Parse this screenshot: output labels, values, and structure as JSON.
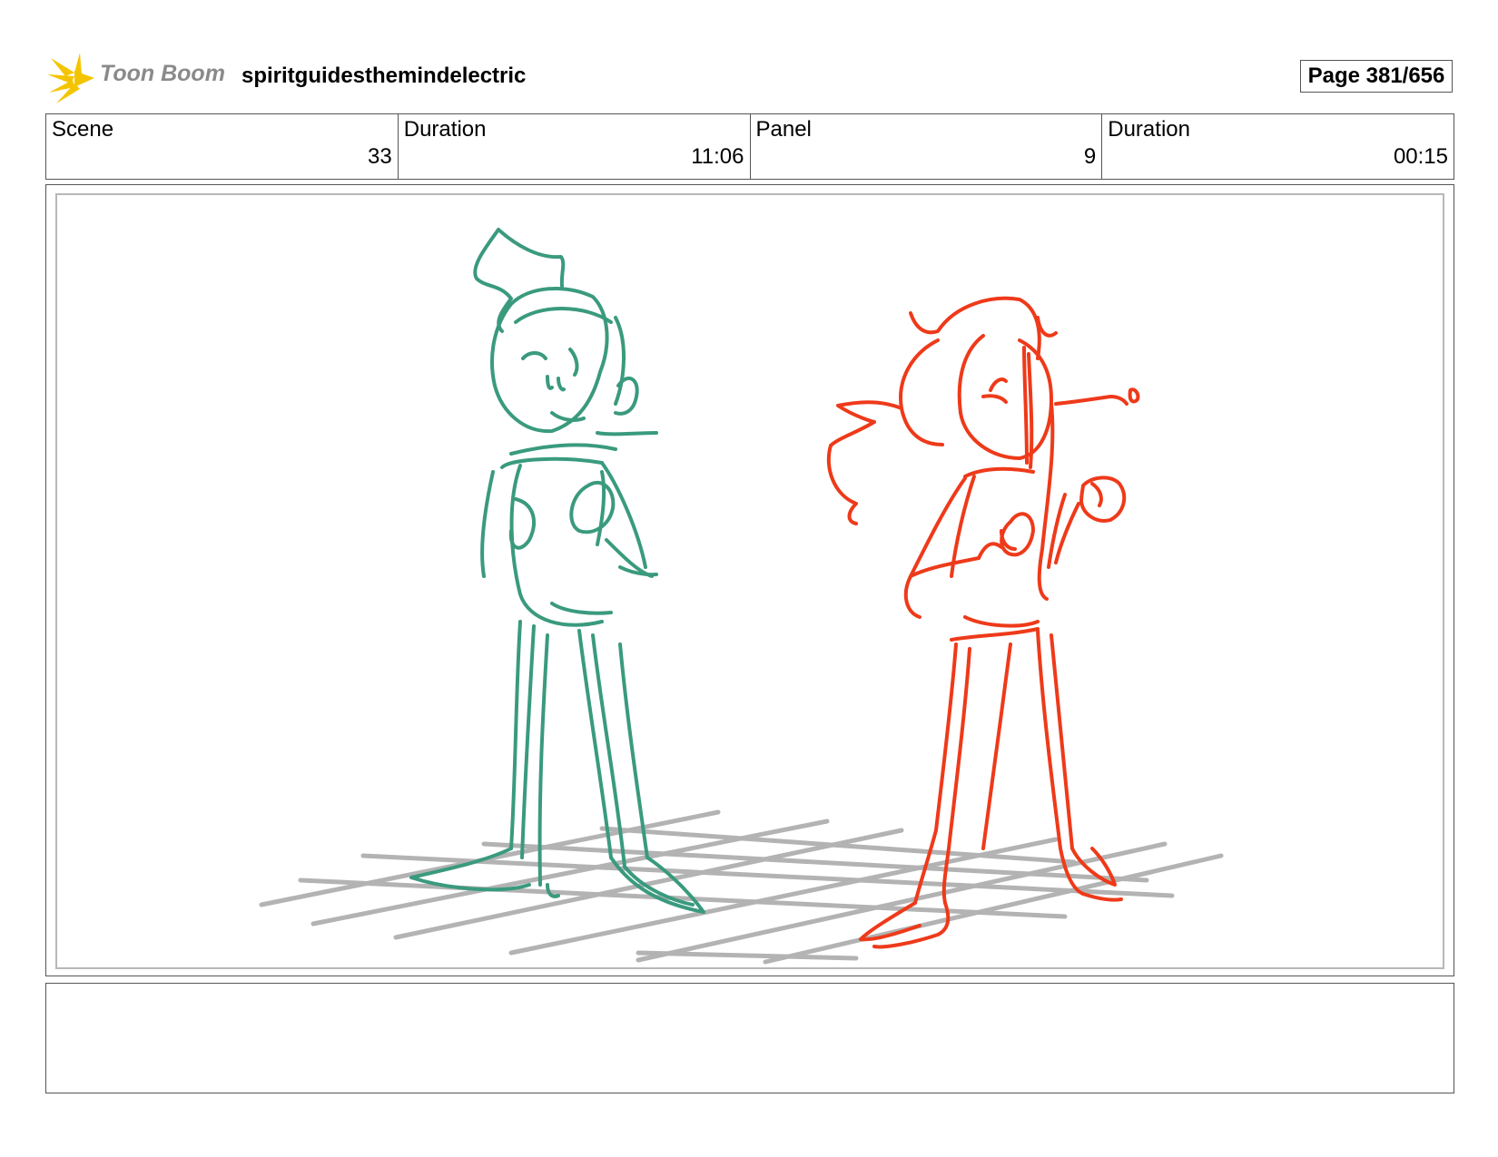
{
  "header": {
    "logo_text": "Toon Boom",
    "project_title": "spiritguidesthemindelectric",
    "page_label": "Page 381/656"
  },
  "info": {
    "scene_label": "Scene",
    "scene_value": "33",
    "scene_duration_label": "Duration",
    "scene_duration_value": "11:06",
    "panel_label": "Panel",
    "panel_value": "9",
    "panel_duration_label": "Duration",
    "panel_duration_value": "00:15"
  },
  "colors": {
    "logo_star": "#f5c400",
    "left_character": "#3a9a7e",
    "right_character": "#ee3a1a",
    "floor_grid": "#b3b3b3"
  },
  "notes": {
    "text": ""
  }
}
